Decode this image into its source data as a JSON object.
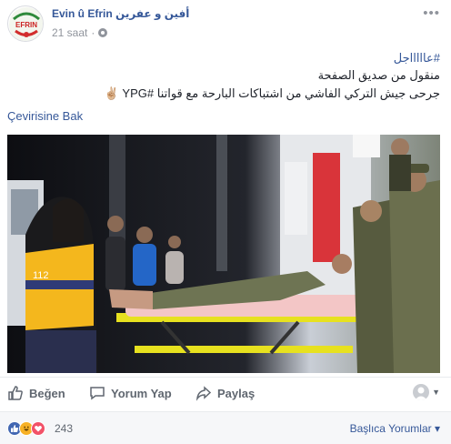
{
  "post": {
    "page_name": "Evin û Efrin أفين و عفرين",
    "timestamp": "21 saat",
    "separator": "·",
    "more_icon": "more-horiz-icon",
    "avatar_text": "EFRIN",
    "lines": {
      "l1": "#عاااااجل",
      "l2": "منقول من صديق الصفحة",
      "l3": "جرحى جيش التركي الفاشي من اشتباكات البارحة مع قواتنا #YPG ✌🏼"
    },
    "translate_link": "Çevirisine Bak"
  },
  "actions": {
    "like": "Beğen",
    "comment": "Yorum Yap",
    "share": "Paylaş"
  },
  "reactions": {
    "count": "243",
    "types": [
      "like-reaction-icon",
      "haha-reaction-icon",
      "love-reaction-icon"
    ],
    "top_comments": "Başlıca Yorumlar ▾"
  },
  "colors": {
    "link": "#365899",
    "muted": "#90949c",
    "action": "#606770",
    "like": "#4267b2",
    "love": "#f25268",
    "haha": "#f7b125"
  }
}
